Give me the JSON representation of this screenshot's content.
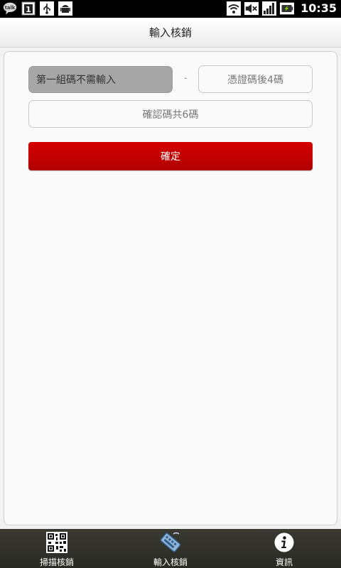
{
  "status_bar": {
    "time": "10:35",
    "talk_label": "talk",
    "notification_count": "1",
    "icons": [
      "talk-icon",
      "notification-count-icon",
      "usb-icon",
      "android-icon",
      "wifi-icon",
      "mute-icon",
      "signal-icon",
      "battery-icon"
    ]
  },
  "header": {
    "title": "輸入核銷"
  },
  "form": {
    "group1_placeholder": "第一組碼不需輸入",
    "separator": "-",
    "last4_placeholder": "憑證碼後4碼",
    "verify_placeholder": "確認碼共6碼",
    "confirm_label": "確定"
  },
  "tabs": [
    {
      "label": "掃描核銷",
      "icon": "qr-code-icon"
    },
    {
      "label": "輸入核銷",
      "icon": "keyboard-icon"
    },
    {
      "label": "資訊",
      "icon": "info-icon"
    }
  ],
  "colors": {
    "accent": "#c60000",
    "tab_bar": "#333330"
  }
}
